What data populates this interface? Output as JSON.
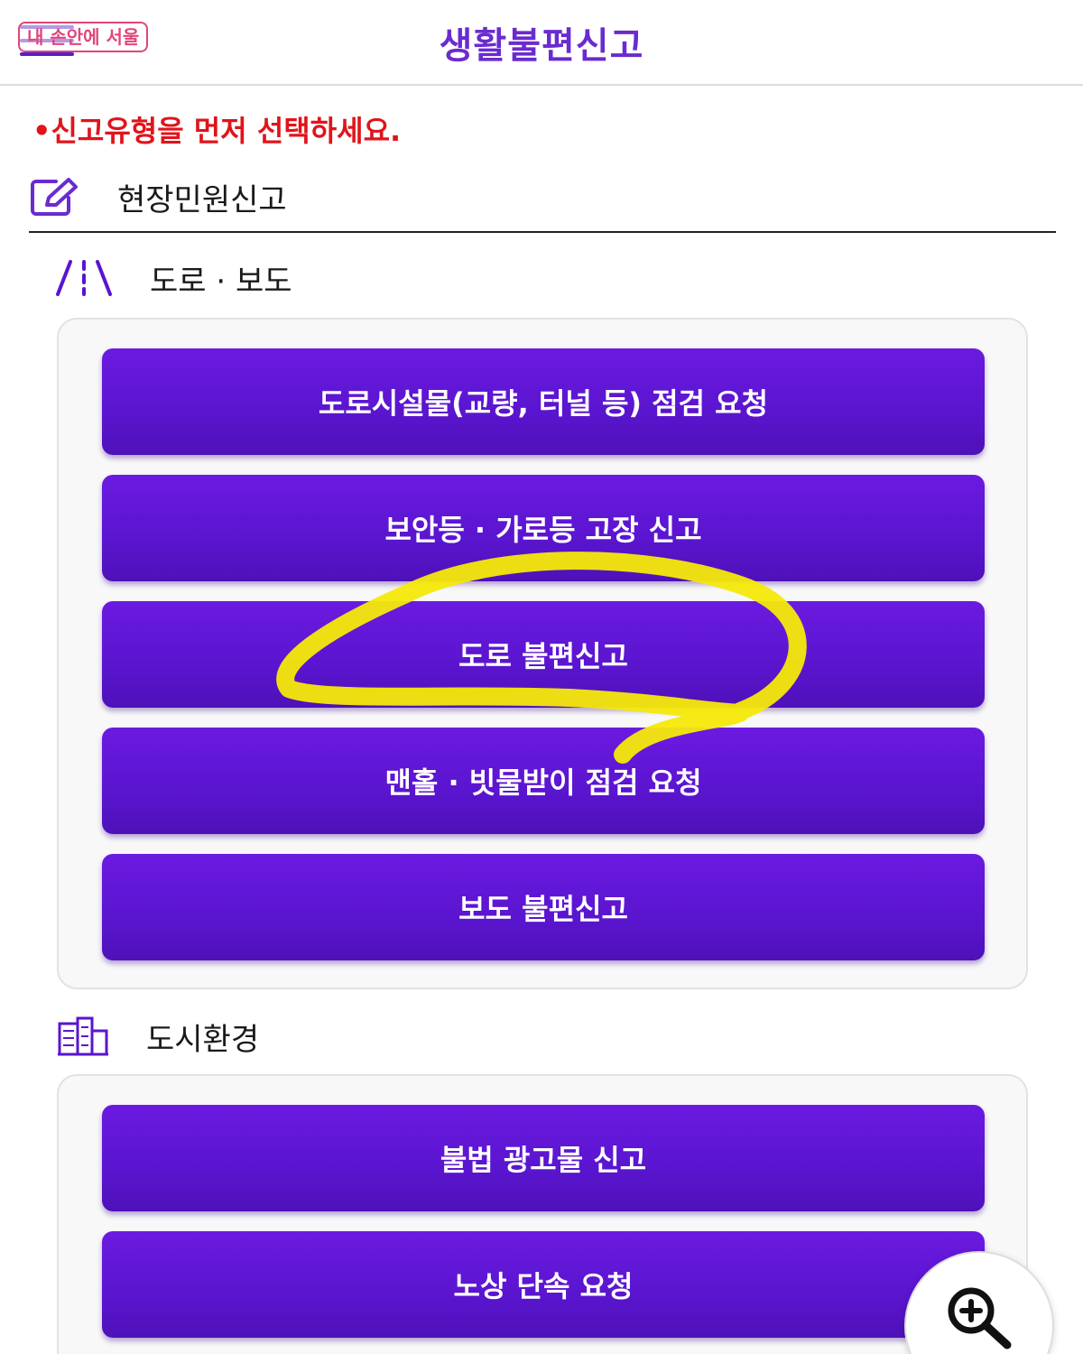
{
  "header": {
    "title": "생활불편신고",
    "watermark": "내 손안에 서울"
  },
  "notice": "•신고유형을 먼저 선택하세요.",
  "field_report": {
    "label": "현장민원신고"
  },
  "categories": [
    {
      "label": "도로 · 보도",
      "icon": "road-icon",
      "buttons": [
        "도로시설물(교량, 터널 등) 점검 요청",
        "보안등 · 가로등 고장 신고",
        "도로 불편신고",
        "맨홀 · 빗물받이 점검 요청",
        "보도 불편신고"
      ]
    },
    {
      "label": "도시환경",
      "icon": "buildings-icon",
      "buttons": [
        "불법 광고물 신고",
        "노상 단속 요청"
      ]
    }
  ],
  "colors": {
    "accent": "#5a15cf",
    "title": "#6a2bd0",
    "notice": "#e0141b",
    "highlight": "#f5e90a"
  }
}
